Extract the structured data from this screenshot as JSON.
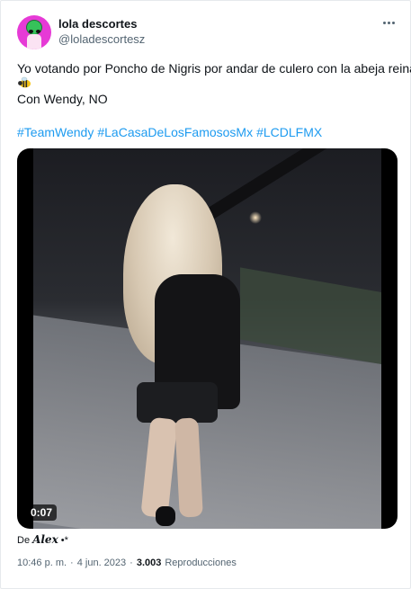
{
  "author": {
    "name": "lola descortes",
    "handle": "@loladescortesz",
    "avatar_color": "#e63ad6"
  },
  "more_icon": "more-horizontal-icon",
  "tweet": {
    "line1": "Yo votando por Poncho de Nigris por andar de culero con la abeja reina",
    "emoji_icon": "bee-icon",
    "line2": "Con Wendy, NO",
    "hashtags": [
      "#TeamWendy",
      "#LaCasaDeLosFamososMx",
      "#LCDLFMX"
    ]
  },
  "video": {
    "duration": "0:07"
  },
  "credit": {
    "prefix": "De",
    "user": "Alex",
    "sparkles": "•*"
  },
  "meta": {
    "time": "10:46 p. m.",
    "sep1": "·",
    "date": "4 jun. 2023",
    "sep2": "·",
    "views": "3.003",
    "views_label": "Reproducciones"
  },
  "colors": {
    "link": "#1d9bf0",
    "secondary": "#536471",
    "text": "#0f1419"
  }
}
